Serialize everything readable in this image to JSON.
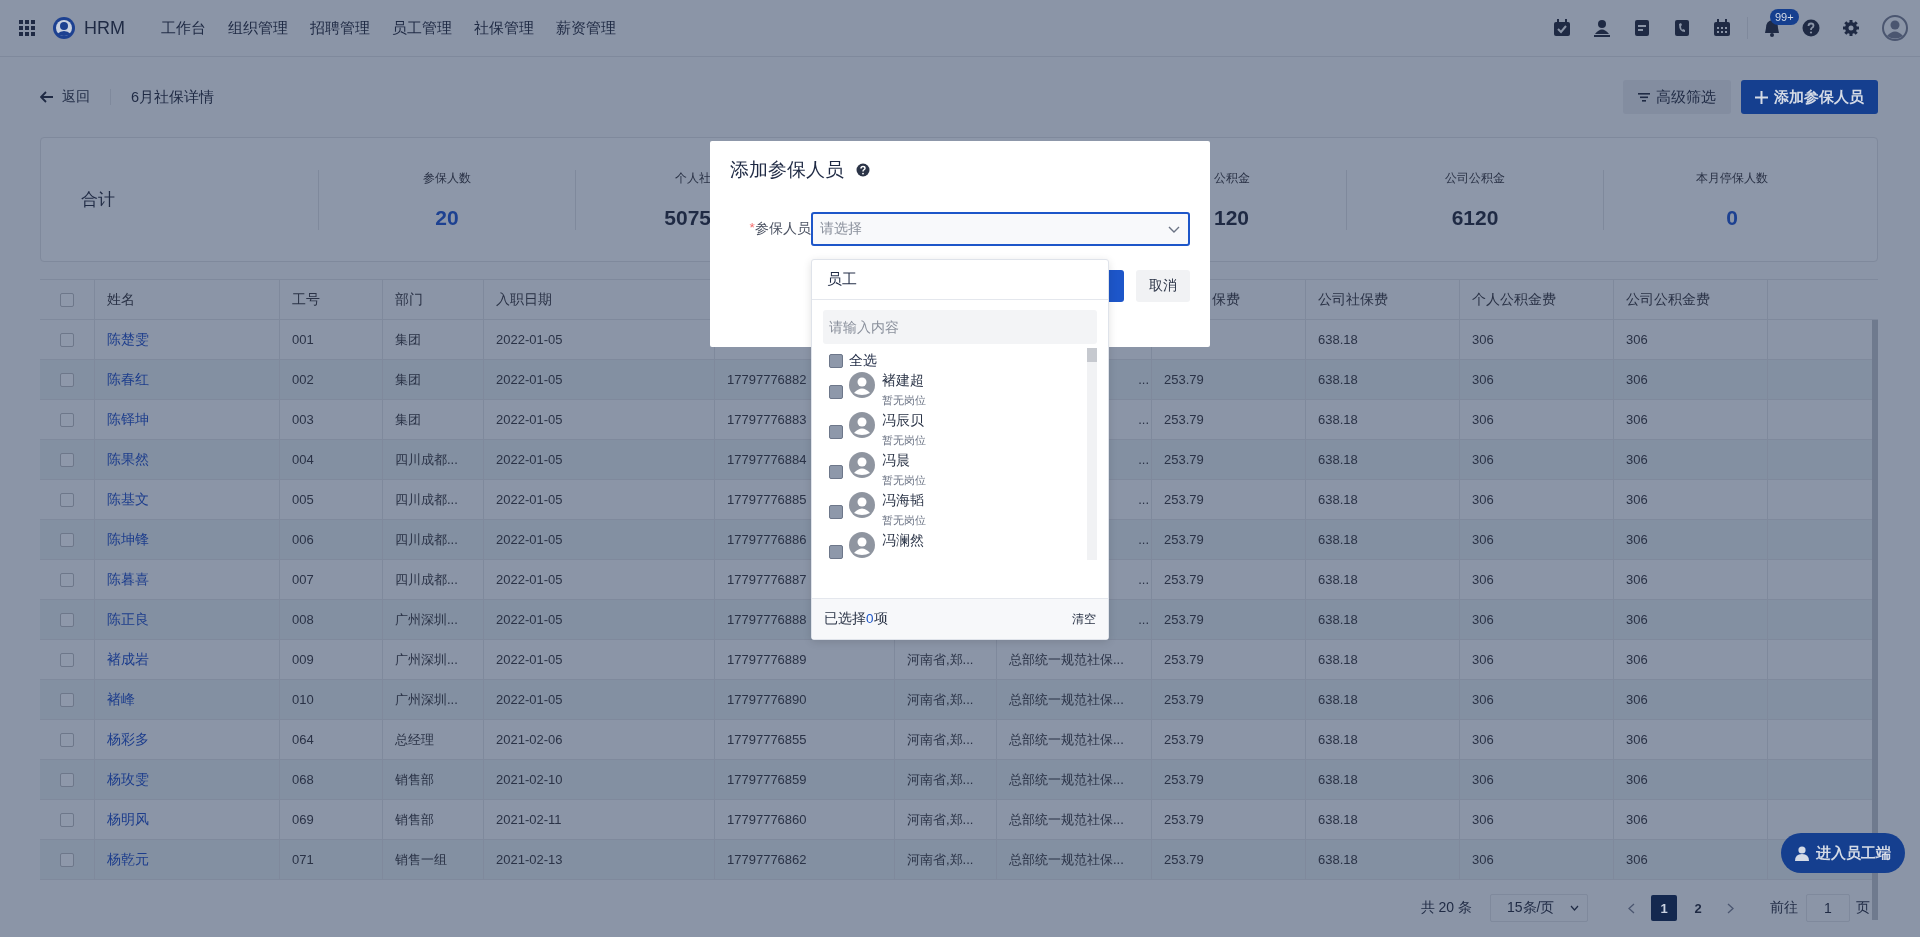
{
  "nav": {
    "brand": "HRM",
    "menu": [
      "工作台",
      "组织管理",
      "招聘管理",
      "员工管理",
      "社保管理",
      "薪资管理"
    ],
    "badge": "99+"
  },
  "header": {
    "back": "返回",
    "title": "6月社保详情",
    "filter_button": "高级筛选",
    "add_button": "添加参保人员"
  },
  "summary": {
    "label": "合计",
    "stats": [
      {
        "label": "参保人数",
        "value": "20",
        "highlight": true
      },
      {
        "label": "个人社",
        "value": "5075",
        "highlight": false
      },
      {
        "label": "公积金",
        "value": "120",
        "highlight": false
      },
      {
        "label": "公司公积金",
        "value": "6120",
        "highlight": false
      },
      {
        "label": "本月停保人数",
        "value": "0",
        "highlight": true
      }
    ]
  },
  "table": {
    "header_checked": false,
    "columns": [
      "姓名",
      "工号",
      "部门",
      "入职日期",
      null,
      null,
      null,
      "保费",
      "公司社保费",
      "个人公积金费",
      "公司公积金费"
    ],
    "rows": [
      {
        "checked": false,
        "cells": [
          "陈楚雯",
          "001",
          "集团",
          "2022-01-05",
          null,
          null,
          null,
          null,
          "638.18",
          "306",
          "306"
        ]
      },
      {
        "checked": false,
        "cells": [
          "陈春红",
          "002",
          "集团",
          "2022-01-05",
          "17797776882",
          null,
          "...",
          "253.79",
          "638.18",
          "306",
          "306"
        ]
      },
      {
        "checked": false,
        "cells": [
          "陈铎坤",
          "003",
          "集团",
          "2022-01-05",
          "17797776883",
          null,
          "...",
          "253.79",
          "638.18",
          "306",
          "306"
        ]
      },
      {
        "checked": false,
        "cells": [
          "陈果然",
          "004",
          "四川成都...",
          "2022-01-05",
          "17797776884",
          null,
          "...",
          "253.79",
          "638.18",
          "306",
          "306"
        ]
      },
      {
        "checked": false,
        "cells": [
          "陈基文",
          "005",
          "四川成都...",
          "2022-01-05",
          "17797776885",
          null,
          "...",
          "253.79",
          "638.18",
          "306",
          "306"
        ]
      },
      {
        "checked": false,
        "cells": [
          "陈坤锋",
          "006",
          "四川成都...",
          "2022-01-05",
          "17797776886",
          null,
          "...",
          "253.79",
          "638.18",
          "306",
          "306"
        ]
      },
      {
        "checked": false,
        "cells": [
          "陈暮喜",
          "007",
          "四川成都...",
          "2022-01-05",
          "17797776887",
          null,
          "...",
          "253.79",
          "638.18",
          "306",
          "306"
        ]
      },
      {
        "checked": false,
        "cells": [
          "陈正良",
          "008",
          "广州深圳...",
          "2022-01-05",
          "17797776888",
          null,
          "...",
          "253.79",
          "638.18",
          "306",
          "306"
        ]
      },
      {
        "checked": false,
        "cells": [
          "褚成岩",
          "009",
          "广州深圳...",
          "2022-01-05",
          "17797776889",
          "河南省,郑...",
          "总部统一规范社保...",
          "253.79",
          "638.18",
          "306",
          "306"
        ]
      },
      {
        "checked": false,
        "cells": [
          "褚峰",
          "010",
          "广州深圳...",
          "2022-01-05",
          "17797776890",
          "河南省,郑...",
          "总部统一规范社保...",
          "253.79",
          "638.18",
          "306",
          "306"
        ]
      },
      {
        "checked": false,
        "cells": [
          "杨彩多",
          "064",
          "总经理",
          "2021-02-06",
          "17797776855",
          "河南省,郑...",
          "总部统一规范社保...",
          "253.79",
          "638.18",
          "306",
          "306"
        ]
      },
      {
        "checked": false,
        "cells": [
          "杨玫雯",
          "068",
          "销售部",
          "2021-02-10",
          "17797776859",
          "河南省,郑...",
          "总部统一规范社保...",
          "253.79",
          "638.18",
          "306",
          "306"
        ]
      },
      {
        "checked": false,
        "cells": [
          "杨明风",
          "069",
          "销售部",
          "2021-02-11",
          "17797776860",
          "河南省,郑...",
          "总部统一规范社保...",
          "253.79",
          "638.18",
          "306",
          "306"
        ]
      },
      {
        "checked": false,
        "cells": [
          "杨乾元",
          "071",
          "销售一组",
          "2021-02-13",
          "17797776862",
          "河南省,郑...",
          "总部统一规范社保...",
          "253.79",
          "638.18",
          "306",
          "306"
        ]
      }
    ]
  },
  "pagination": {
    "total": "共 20 条",
    "page_size": "15条/页",
    "pages": [
      {
        "label": "1",
        "selected": true
      },
      {
        "label": "2",
        "selected": false
      }
    ],
    "goto_label": "前往",
    "goto_value": "1",
    "goto_unit": "页"
  },
  "employee_portal_button": "进入员工端",
  "modal": {
    "title": "添加参保人员",
    "required_mark": "*",
    "field_label": "参保人员",
    "placeholder": "请选择",
    "cancel_button": "取消",
    "dropdown": {
      "header": "员工",
      "search_placeholder": "请输入内容",
      "select_all": {
        "label": "全选",
        "checked": false
      },
      "employees": [
        {
          "name": "褚建超",
          "position": "暂无岗位",
          "checked": false
        },
        {
          "name": "冯辰贝",
          "position": "暂无岗位",
          "checked": false
        },
        {
          "name": "冯晨",
          "position": "暂无岗位",
          "checked": false
        },
        {
          "name": "冯海韬",
          "position": "暂无岗位",
          "checked": false
        },
        {
          "name": "冯澜然",
          "checked": false
        }
      ],
      "summary_prefix": "已选择",
      "summary_count": "0",
      "summary_unit": "项",
      "clear_button": "清空"
    }
  }
}
